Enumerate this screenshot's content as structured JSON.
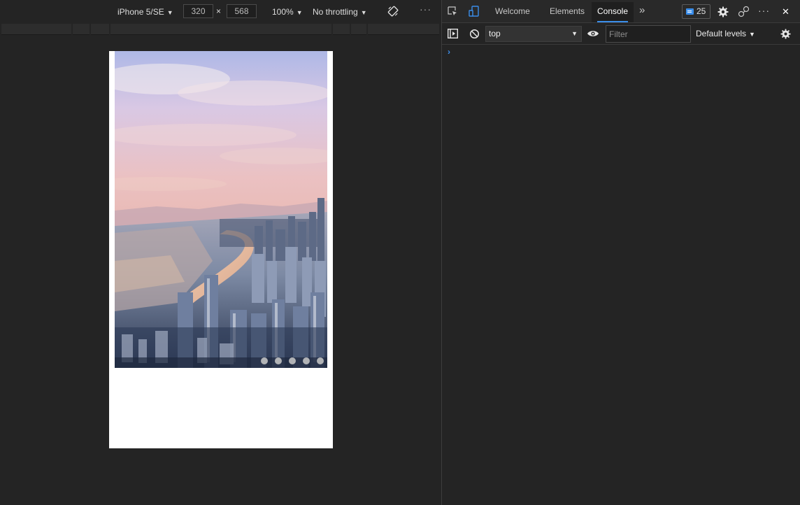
{
  "device_toolbar": {
    "device_name": "iPhone 5/SE",
    "width_value": "320",
    "height_value": "568",
    "times_symbol": "×",
    "zoom": "100%",
    "throttling": "No throttling",
    "caret": "▼",
    "rotate_icon": "rotate-icon",
    "more_icon": "more-horizontal-icon",
    "more_glyph": "···"
  },
  "viewport": {
    "carousel": {
      "image": "city-skyline-sunset-photo",
      "dot_count": 5,
      "active_dot": 1
    }
  },
  "devtools": {
    "tabs": {
      "welcome": "Welcome",
      "elements": "Elements",
      "console": "Console",
      "overflow_glyph": "»"
    },
    "issues_count": "25",
    "close_glyph": "✕",
    "more_glyph": "···",
    "icons": [
      "inspect-element-icon",
      "device-emulation-icon",
      "chevron-more-tabs-icon",
      "issues-message-icon",
      "settings-gear-icon",
      "connected-devices-icon",
      "more-options-icon",
      "close-icon"
    ],
    "console_toolbar": {
      "context": "top",
      "filter_placeholder": "Filter",
      "levels": "Default levels",
      "caret": "▼"
    },
    "prompt_glyph": "›"
  },
  "colors": {
    "background": "#242424",
    "accent": "#3b8eea",
    "viewport_bg": "#ffffff"
  }
}
